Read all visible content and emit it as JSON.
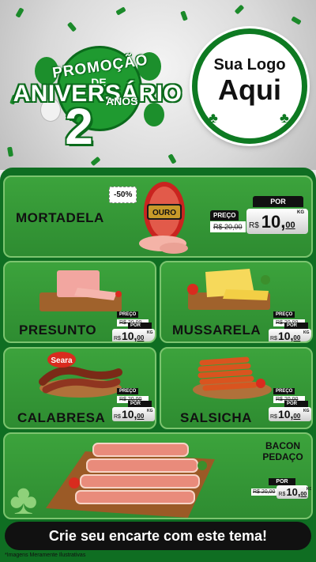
{
  "header": {
    "promo_text": "PROMOÇÃO",
    "de_text": "DE",
    "aniversario_text": "ANIVERSÁRIO",
    "number": "2",
    "anos_text": "ANOS",
    "logo_line1": "Sua Logo",
    "logo_line2": "Aqui"
  },
  "featured": {
    "name": "MORTADELA",
    "discount": "-50%",
    "brand": "OURO",
    "price_label": "PREÇO",
    "por_label": "POR",
    "old_price": "R$ 20,00",
    "currency": "R$",
    "price_int": "10,",
    "price_cents": "00",
    "unit": "KG"
  },
  "products": [
    {
      "name": "PRESUNTO",
      "price_label": "PREÇO",
      "old_price": "R$ 20,00",
      "por_label": "POR",
      "currency": "R$",
      "price_int": "10,",
      "price_cents": "00",
      "unit": "KG"
    },
    {
      "name": "MUSSARELA",
      "price_label": "PREÇO",
      "old_price": "R$ 20,00",
      "por_label": "POR",
      "currency": "R$",
      "price_int": "10,",
      "price_cents": "00",
      "unit": "KG"
    },
    {
      "name": "CALABRESA",
      "brand": "Seara",
      "price_label": "PREÇO",
      "old_price": "R$ 20,00",
      "por_label": "POR",
      "currency": "R$",
      "price_int": "10,",
      "price_cents": "00",
      "unit": "KG"
    },
    {
      "name": "SALSICHA",
      "price_label": "PREÇO",
      "old_price": "R$ 20,00",
      "por_label": "POR",
      "currency": "R$",
      "price_int": "10,",
      "price_cents": "00",
      "unit": "KG"
    }
  ],
  "bacon": {
    "name_line1": "BACON",
    "name_line2": "PEDAÇO",
    "por_label": "POR",
    "old_price": "R$ 20,00",
    "currency": "R$",
    "price_int": "10,",
    "price_cents": "00",
    "unit": "KG"
  },
  "footer": {
    "banner": "Crie seu encarte com este tema!",
    "note": "*Imagens Meramente Ilustrativas"
  },
  "colors": {
    "green_dark": "#0f6e22",
    "green": "#2e8c31",
    "logo_ring": "#0e7a22"
  }
}
